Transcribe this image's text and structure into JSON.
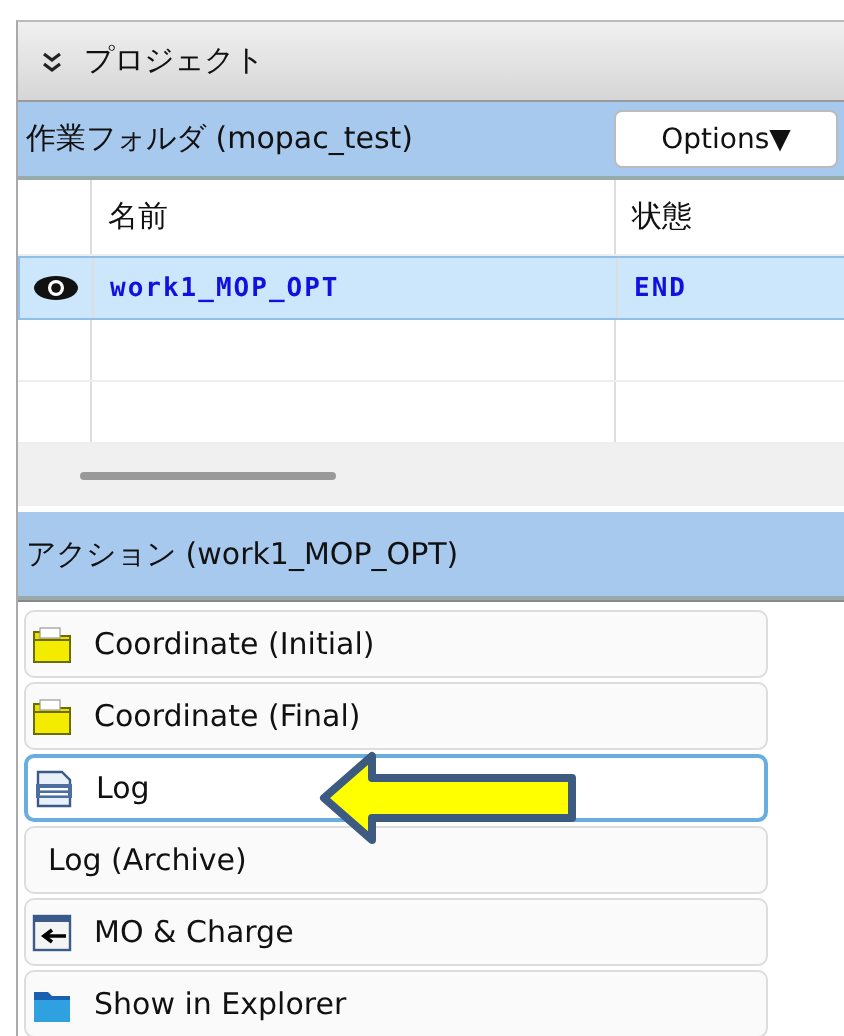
{
  "panel": {
    "title": "プロジェクト",
    "expanded": true
  },
  "folder": {
    "title": "作業フォルダ (mopac_test)",
    "options_button": "Options▼"
  },
  "table": {
    "columns": [
      "名前",
      "状態"
    ],
    "rows": [
      {
        "visible": true,
        "name": "work1_MOP_OPT",
        "status": "END",
        "selected": true
      }
    ]
  },
  "actions": {
    "title": "アクション (work1_MOP_OPT)",
    "items": [
      {
        "label": "Coordinate (Initial)",
        "kind": "folder",
        "selected": false
      },
      {
        "label": "Coordinate (Final)",
        "kind": "folder",
        "selected": false
      },
      {
        "label": "Log",
        "kind": "log",
        "selected": true
      },
      {
        "label": "Log (Archive)",
        "kind": "plain",
        "selected": false
      },
      {
        "label": "MO & Charge",
        "kind": "window",
        "selected": false
      },
      {
        "label": "Show in Explorer",
        "kind": "explorer",
        "selected": false
      }
    ]
  }
}
